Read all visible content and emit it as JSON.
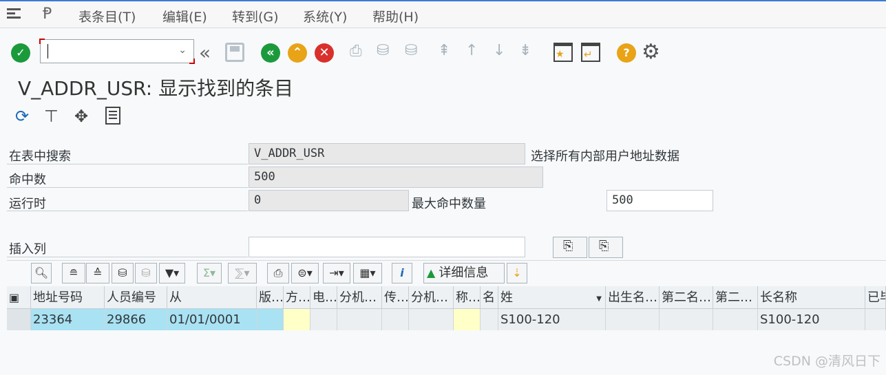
{
  "menubar": {
    "items": [
      "表条目(T)",
      "编辑(E)",
      "转到(G)",
      "系统(Y)",
      "帮助(H)"
    ]
  },
  "toolbar": {
    "command_value": "",
    "icons": [
      "enter-check-icon",
      "back-double-icon",
      "save-icon",
      "back-icon",
      "exit-icon",
      "cancel-icon",
      "print-icon",
      "find-icon",
      "find-next-icon",
      "first-page-icon",
      "prev-page-icon",
      "next-page-icon",
      "last-page-icon",
      "create-session-icon",
      "shortcut-icon",
      "help-icon",
      "settings-icon"
    ]
  },
  "title": "V_ADDR_USR: 显示找到的条目",
  "form": {
    "search_table_label": "在表中搜索",
    "search_table_value": "V_ADDR_USR",
    "search_table_desc": "选择所有内部用户地址数据",
    "hits_label": "命中数",
    "hits_value": "500",
    "runtime_label": "运行时",
    "runtime_value": "0",
    "max_hits_label": "最大命中数量",
    "max_hits_value": "500",
    "insert_col_label": "插入列",
    "insert_col_value": ""
  },
  "alv": {
    "details_label": "详细信息",
    "columns": [
      "地址号码",
      "人员编号",
      "从",
      "版…",
      "方…",
      "电…",
      "分机…",
      "传…",
      "分机…",
      "称…",
      "名",
      "姓",
      "出生名…",
      "第二名…",
      "第二…",
      "长名称",
      "已毕"
    ],
    "rows": [
      [
        "23364",
        "29866",
        "01/01/0001",
        "",
        "",
        "",
        "",
        "",
        "",
        "",
        "",
        "S100-120",
        "",
        "",
        "",
        "S100-120",
        ""
      ]
    ]
  },
  "watermark": "CSDN @清风日下",
  "colors": {
    "accent_green": "#1b9a3c",
    "accent_orange": "#e8a317",
    "accent_red": "#d9302c",
    "key_cell": "#a9e2f3",
    "yellow_cell": "#ffffc8"
  }
}
